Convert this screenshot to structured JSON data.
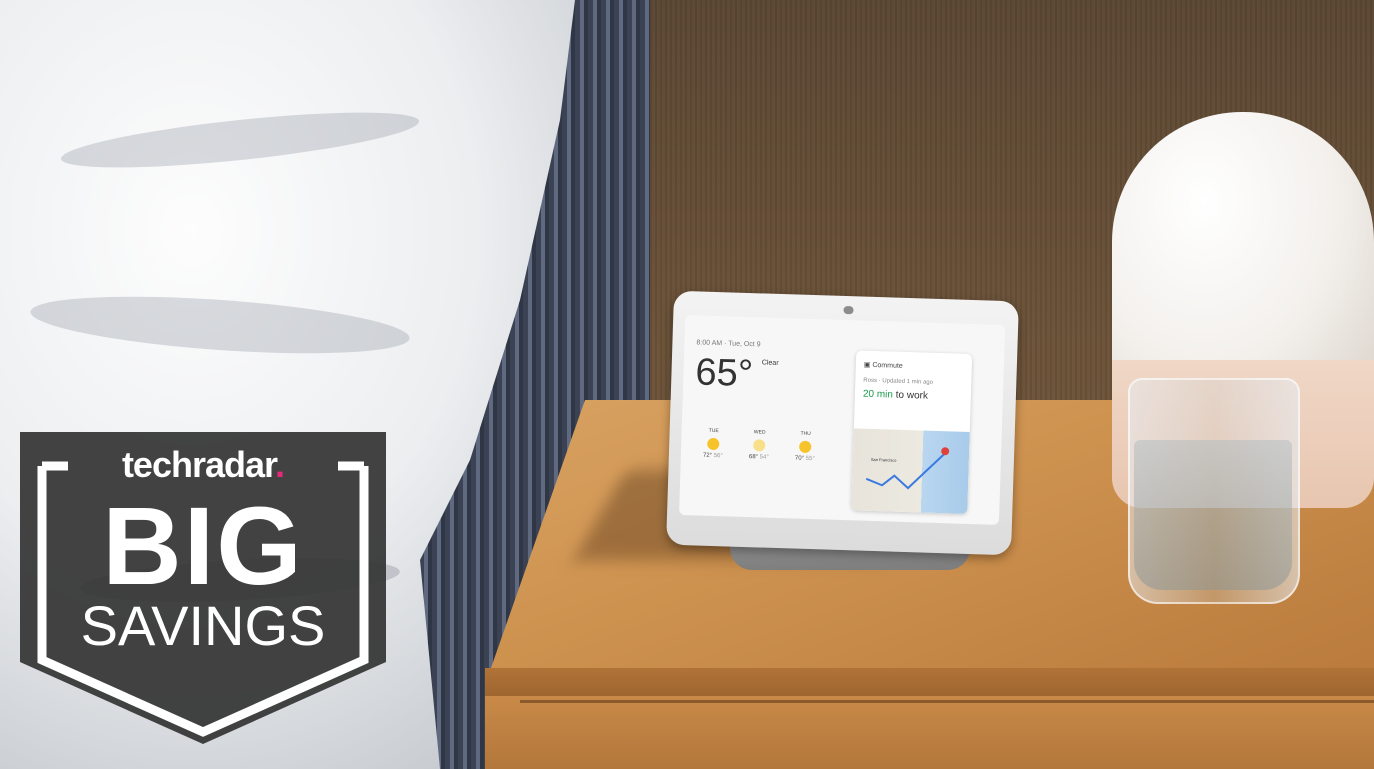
{
  "badge": {
    "brand": "techradar",
    "brand_dot": ".",
    "line1": "BIG",
    "line2": "SAVINGS",
    "colors": {
      "panel": "#333333",
      "text": "#ffffff",
      "accent": "#e8287a"
    }
  },
  "smart_display": {
    "time_date": "8:00 AM · Tue, Oct 9",
    "temperature": "65°",
    "condition": "Clear",
    "forecast": [
      {
        "day": "TUE",
        "high": "72°",
        "low": "56°"
      },
      {
        "day": "WED",
        "high": "68°",
        "low": "54°"
      },
      {
        "day": "THU",
        "high": "70°",
        "low": "55°"
      }
    ],
    "commute": {
      "title": "Commute",
      "subtitle": "Ross · Updated 1 min ago",
      "eta_value": "20 min",
      "eta_suffix": " to work",
      "map_label": "San Francisco"
    }
  }
}
